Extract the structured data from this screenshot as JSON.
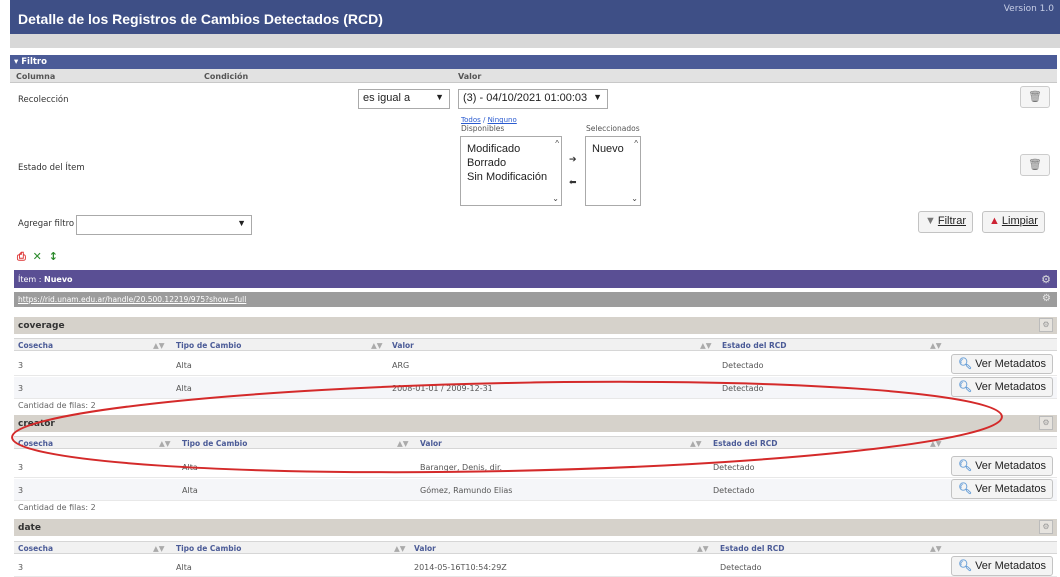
{
  "header": {
    "title": "Detalle de los Registros de Cambios Detectados (RCD)",
    "version": "Version 1.0"
  },
  "filter": {
    "section_title": "Filtro",
    "columns": {
      "column": "Columna",
      "condition": "Condición",
      "value": "Valor"
    },
    "rows": {
      "recoleccion": {
        "label": "Recolección",
        "condition": "es igual a",
        "value": "(3) - 04/10/2021 01:00:03"
      },
      "estado": {
        "label": "Estado del Ítem",
        "links": {
          "all": "Todos",
          "separator": " / ",
          "none": "Ninguno"
        },
        "available_label": "Disponibles",
        "selected_label": "Seleccionados",
        "available": [
          "Modificado",
          "Borrado",
          "Sin Modificación"
        ],
        "selected": [
          "Nuevo"
        ]
      }
    },
    "add_filter_label": "Agregar filtro",
    "filter_button": "Filtrar",
    "clear_button": "Limpiar"
  },
  "item": {
    "label": "Ítem :",
    "value": "Nuevo",
    "url": "https://rid.unam.edu.ar/handle/20.500.12219/975?show=full"
  },
  "table_columns": [
    "Cosecha",
    "Tipo de Cambio",
    "Valor",
    "Estado del RCD"
  ],
  "row_button": "Ver Metadatos",
  "groups": [
    {
      "name": "coverage",
      "rows": [
        {
          "cosecha": "3",
          "tipo": "Alta",
          "valor": "ARG",
          "estado": "Detectado"
        },
        {
          "cosecha": "3",
          "tipo": "Alta",
          "valor": "2008-01-01 / 2009-12-31",
          "estado": "Detectado"
        }
      ],
      "count": "Cantidad de filas: 2"
    },
    {
      "name": "creator",
      "rows": [
        {
          "cosecha": "3",
          "tipo": "Alta",
          "valor": "Baranger, Denis, dir.",
          "estado": "Detectado"
        },
        {
          "cosecha": "3",
          "tipo": "Alta",
          "valor": "Gómez, Ramundo Elias",
          "estado": "Detectado"
        }
      ],
      "count": "Cantidad de filas: 2"
    },
    {
      "name": "date",
      "rows": [
        {
          "cosecha": "3",
          "tipo": "Alta",
          "valor": "2014-05-16T10:54:29Z",
          "estado": "Detectado"
        }
      ]
    }
  ],
  "colors": {
    "header_blue": "#3e4f86",
    "item_purple": "#5a4f94",
    "annotation_red": "#d42a2a"
  }
}
